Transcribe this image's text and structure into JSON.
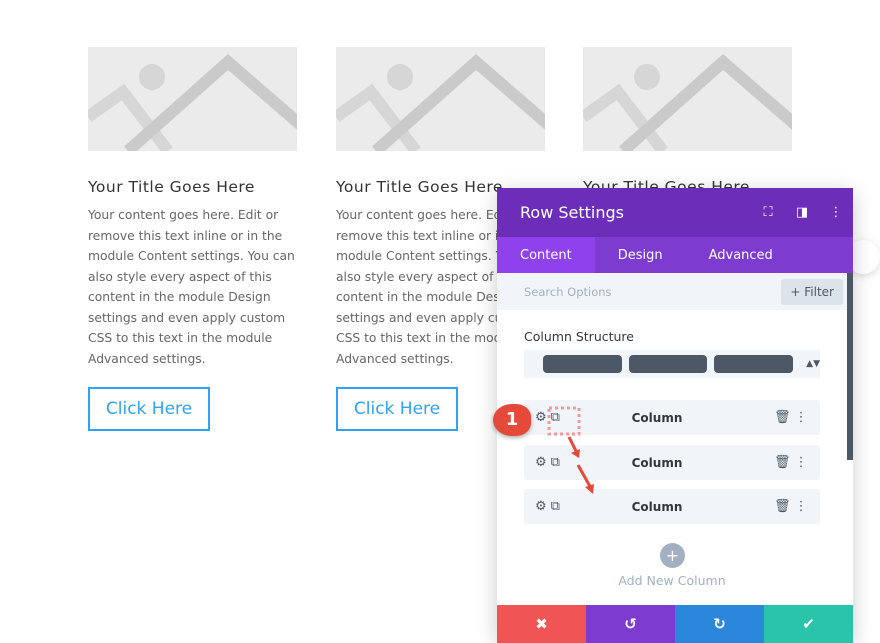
{
  "cards": [
    {
      "title": "Your Title Goes Here",
      "body": "Your content goes here. Edit or remove this text inline or in the module Content settings. You can also style every aspect of this content in the module Design settings and even apply custom CSS to this text in the module Advanced settings.",
      "button": "Click Here"
    },
    {
      "title": "Your Title Goes Here",
      "body": "Your content goes here. Edit or remove this text inline or in the module Content settings. You can also style every aspect of this content in the module Design settings and even apply custom CSS to this text in the module Advanced settings.",
      "button": "Click Here"
    },
    {
      "title": "Your Title Goes Here",
      "body": "",
      "button": ""
    }
  ],
  "panel": {
    "title": "Row Settings",
    "tabs": [
      "Content",
      "Design",
      "Advanced"
    ],
    "search_placeholder": "Search Options",
    "filter": "+ Filter",
    "structure_label": "Column Structure",
    "columns": [
      "Column",
      "Column",
      "Column"
    ],
    "add_column": "Add New Column",
    "annotation": "1"
  },
  "colors": {
    "header": "#6c2eb9",
    "tabs": "#7e3bd0",
    "cancel": "#ef5555",
    "undo": "#7e3bd0",
    "redo": "#2b87da",
    "save": "#29c4a9",
    "link": "#2ea3f2"
  }
}
